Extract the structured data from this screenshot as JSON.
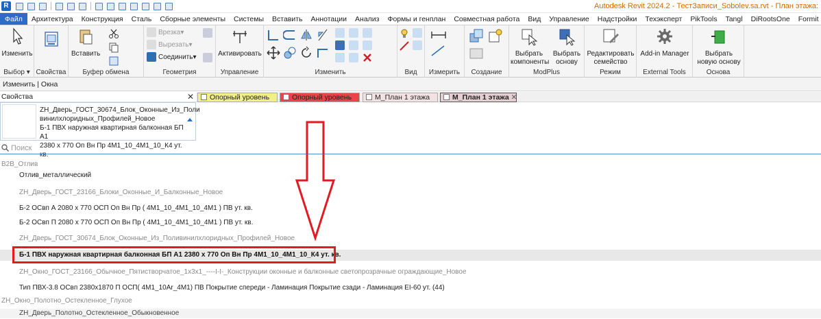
{
  "app": {
    "title": "Autodesk Revit 2024.2 - ТестЗаписи_Sobolev.sa.rvt - План этажа:"
  },
  "tabs": [
    "Файл",
    "Архитектура",
    "Конструкция",
    "Сталь",
    "Сборные элементы",
    "Системы",
    "Вставить",
    "Аннотации",
    "Анализ",
    "Формы и генплан",
    "Совместная работа",
    "Вид",
    "Управление",
    "Надстройки",
    "Техэксперт",
    "PikTools",
    "Tangl",
    "DiRootsOne",
    "Formit Exporter"
  ],
  "ribbon": {
    "modify": "Изменить",
    "select_panel": "Выбор",
    "properties": "Свойства",
    "paste": "Вставить",
    "clipboard_panel": "Буфер обмена",
    "cut_in": "Врезка",
    "cut_out": "Вырезать",
    "join": "Соединить",
    "geometry_panel": "Геометрия",
    "activate": "Активировать",
    "control_panel": "Управление",
    "modify_panel": "Изменить",
    "view_panel": "Вид",
    "measure_panel": "Измерить",
    "create_panel": "Создание",
    "select_components": "Выбрать компоненты",
    "select_base": "Выбрать основу",
    "modplus_panel": "ModPlus",
    "edit_family": "Редактировать семейство",
    "mode_panel": "Режим",
    "addin_manager": "Add-in Manager",
    "external_tools": "External Tools",
    "select_new_base": "Выбрать новую основу",
    "base_panel": "Основа"
  },
  "context": "Изменить | Окна",
  "properties_title": "Свойства",
  "view_tabs": [
    "Опорный уровень",
    "Опорный уровень",
    "М_План 1 этажа",
    "М_План 1 этажа"
  ],
  "type_selector": {
    "line1": "ZH_Дверь_ГОСТ_30674_Блок_Оконные_Из_Поли",
    "line2": "винилхлоридных_Профилей_Новое",
    "line3": "Б-1 ПВХ наружная квартирная балконная БП А1",
    "line4": "2380 x 770 Оп Вн Пр 4М1_10_4М1_10_К4 ут. кв."
  },
  "search_placeholder": "Поиск",
  "list": [
    "B2B_Отлив",
    "Отлив_металлический",
    "ZH_Дверь_ГОСТ_23166_Блоки_Оконные_И_Балконные_Новое",
    "Б-2 ОСвп А 2080 х 770 ОСП Оп Вн Пр ( 4М1_10_4М1_10_4М1 ) ПВ ут. кв.",
    "Б-2 ОСвп П 2080 х 770 ОСП Оп Вн Пр ( 4М1_10_4М1_10_4М1 ) ПВ ут. кв.",
    "ZH_Дверь_ГОСТ_30674_Блок_Оконные_Из_Поливинилхлоридных_Профилей_Новое",
    "Б-1 ПВХ наружная квартирная балконная БП А1 2380 x 770 Оп Вн Пр 4М1_10_4М1_10_К4 ут. кв.",
    "ZH_Окно_ГОСТ_23166_Обычное_Пятистворчатое_1x3x1_----I-I-_Конструкции оконные и балконные светопрозрачные ограждающие_Новое",
    "Тип ПВХ-3.8 ОСвп 2380x1870 П ОСП( 4М1_10Ar_4М1) ПВ Покрытие спереди - Ламинация Покрытие сзади - Ламинация EI-60 ут. (44)",
    "ZH_Окно_Полотно_Остекленное_Глухое",
    "ZH_Дверь_Полотно_Остекленное_Обыкновенное"
  ],
  "colors": {
    "accent": "#2e6ac7",
    "highlight_box": "#e11b22",
    "view_tab_yellow": "#f1ef8a",
    "view_tab_red": "#e8444a"
  }
}
